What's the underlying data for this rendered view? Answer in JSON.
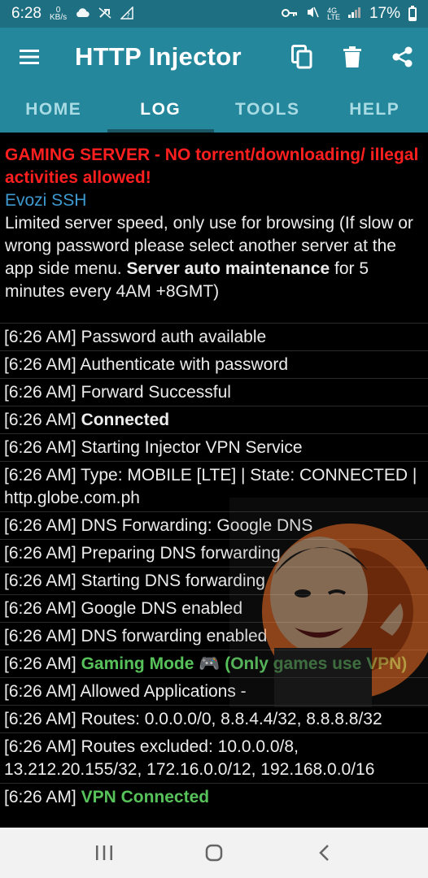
{
  "status": {
    "time": "6:28",
    "speed": "0",
    "speed_unit": "KB/s",
    "battery": "17%"
  },
  "appbar": {
    "title": "HTTP Injector"
  },
  "tabs": [
    {
      "label": "HOME"
    },
    {
      "label": "LOG"
    },
    {
      "label": "TOOLS"
    },
    {
      "label": "HELP"
    }
  ],
  "notice": {
    "warning": "GAMING SERVER - NO torrent/downloading/ illegal activities allowed!",
    "server": "Evozi SSH",
    "text1": "Limited server speed, only use for browsing (If slow or wrong password please select another server at the app side menu. ",
    "bold": "Server auto maintenance",
    "text2": " for 5 minutes every 4AM +8GMT)"
  },
  "log": [
    {
      "ts": "[6:26 AM]",
      "text": " Password auth available",
      "bold": ""
    },
    {
      "ts": "[6:26 AM]",
      "text": " Authenticate with password",
      "bold": ""
    },
    {
      "ts": "[6:26 AM]",
      "text": " Forward Successful",
      "bold": ""
    },
    {
      "ts": "[6:26 AM]",
      "text": " ",
      "bold": "Connected"
    },
    {
      "ts": "[6:26 AM]",
      "text": " Starting Injector VPN Service",
      "bold": ""
    },
    {
      "ts": "[6:26 AM]",
      "text": " Type: MOBILE [LTE] | State: CONNECTED | http.globe.com.ph",
      "bold": ""
    },
    {
      "ts": "[6:26 AM]",
      "text": " DNS Forwarding: Google DNS",
      "bold": ""
    },
    {
      "ts": "[6:26 AM]",
      "text": " Preparing DNS forwarding",
      "bold": ""
    },
    {
      "ts": "[6:26 AM]",
      "text": " Starting DNS forwarding",
      "bold": ""
    },
    {
      "ts": "[6:26 AM]",
      "text": " Google DNS enabled",
      "bold": ""
    },
    {
      "ts": "[6:26 AM]",
      "text": " DNS forwarding enabled",
      "bold": ""
    },
    {
      "ts": "[6:26 AM]",
      "text": " ",
      "bold": "Gaming Mode 🎮 (Only games use VPN)"
    },
    {
      "ts": "[6:26 AM]",
      "text": " Allowed Applications -",
      "bold": ""
    },
    {
      "ts": "[6:26 AM]",
      "text": " Routes: 0.0.0.0/0, 8.8.4.4/32, 8.8.8.8/32",
      "bold": ""
    },
    {
      "ts": "[6:26 AM]",
      "text": " Routes excluded: 10.0.0.0/8, 13.212.20.155/32, 172.16.0.0/12, 192.168.0.0/16",
      "bold": ""
    },
    {
      "ts": "[6:26 AM]",
      "text": " ",
      "bold": "VPN Connected"
    }
  ],
  "colors": {
    "appbar": "#25879b",
    "warning": "#ff1f1f",
    "server": "#3d9ad1",
    "success": "#57c25a"
  }
}
